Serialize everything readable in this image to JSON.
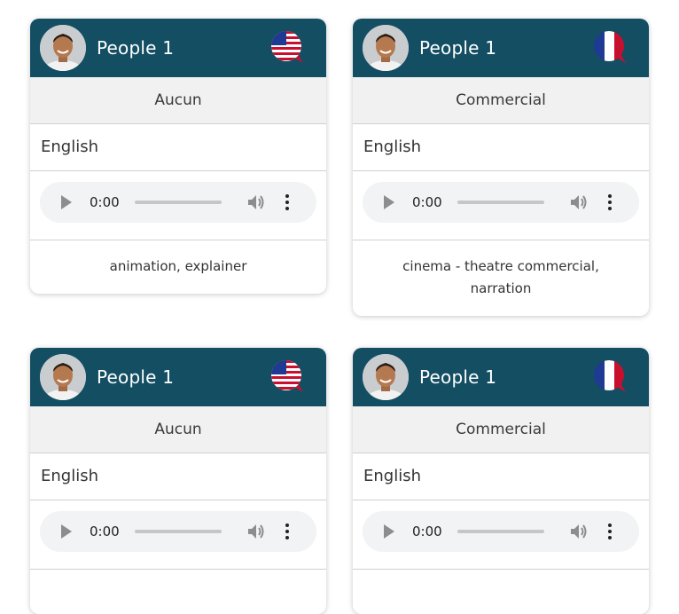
{
  "cards": [
    {
      "name": "People 1",
      "flag": "us-flag-speech-bubble-icon",
      "category": "Aucun",
      "language": "English",
      "audio": {
        "time": "0:00"
      },
      "tags": "animation, explainer"
    },
    {
      "name": "People 1",
      "flag": "france-flag-speech-bubble-icon",
      "category": "Commercial",
      "language": "English",
      "audio": {
        "time": "0:00"
      },
      "tags": "cinema - theatre commercial, narration"
    },
    {
      "name": "People 1",
      "flag": "us-flag-speech-bubble-icon",
      "category": "Aucun",
      "language": "English",
      "audio": {
        "time": "0:00"
      },
      "tags": ""
    },
    {
      "name": "People 1",
      "flag": "france-flag-speech-bubble-icon",
      "category": "Commercial",
      "language": "English",
      "audio": {
        "time": "0:00"
      },
      "tags": ""
    }
  ],
  "colors": {
    "header": "#134e63",
    "category_bg": "#f1f1f1",
    "player_bg": "#f1f3f4"
  }
}
